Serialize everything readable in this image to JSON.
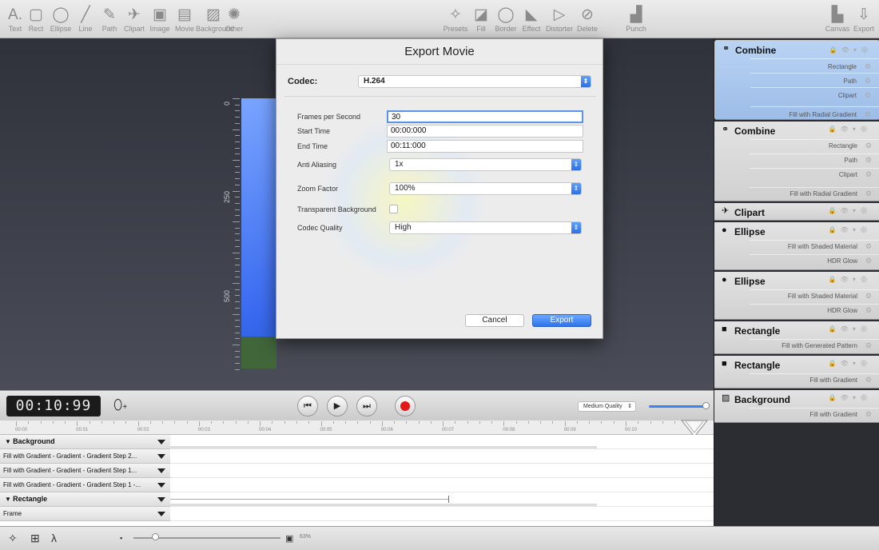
{
  "toolbar": {
    "left": [
      {
        "label": "Text",
        "icon": "text-tool-icon",
        "glyph": "A."
      },
      {
        "label": "Rect",
        "icon": "rect-tool-icon",
        "glyph": "▢"
      },
      {
        "label": "Ellipse",
        "icon": "ellipse-tool-icon",
        "glyph": "◯"
      },
      {
        "label": "Line",
        "icon": "line-tool-icon",
        "glyph": "╱"
      },
      {
        "label": "Path",
        "icon": "path-tool-icon",
        "glyph": "✎"
      },
      {
        "label": "Clipart",
        "icon": "clipart-tool-icon",
        "glyph": "✈"
      },
      {
        "label": "Image",
        "icon": "image-tool-icon",
        "glyph": "▣"
      },
      {
        "label": "Movie",
        "icon": "movie-tool-icon",
        "glyph": "▤"
      },
      {
        "label": "Background",
        "icon": "background-tool-icon",
        "glyph": "▨"
      },
      {
        "label": "Other",
        "icon": "other-tool-icon",
        "glyph": "✺"
      }
    ],
    "right": [
      {
        "label": "Presets",
        "icon": "presets-icon",
        "glyph": "✧"
      },
      {
        "label": "Fill",
        "icon": "fill-icon",
        "glyph": "◪"
      },
      {
        "label": "Border",
        "icon": "border-icon",
        "glyph": "◯"
      },
      {
        "label": "Effect",
        "icon": "effect-icon",
        "glyph": "◣"
      },
      {
        "label": "Distorter",
        "icon": "distorter-icon",
        "glyph": "▷"
      },
      {
        "label": "Delete",
        "icon": "delete-icon",
        "glyph": "⊘"
      }
    ],
    "punch": {
      "label": "Punch",
      "icon": "punch-icon",
      "glyph": "▟"
    },
    "canvas": {
      "label": "Canvas",
      "icon": "canvas-icon",
      "glyph": "▙"
    },
    "export": {
      "label": "Export",
      "icon": "export-icon",
      "glyph": "⇩"
    }
  },
  "ruler": {
    "labels": [
      "0",
      "250",
      "500"
    ]
  },
  "modal": {
    "title": "Export Movie",
    "codec_label": "Codec:",
    "codec_value": "H.264",
    "fps_label": "Frames per Second",
    "fps_value": "30",
    "start_label": "Start Time",
    "start_value": "00:00:000",
    "end_label": "End Time",
    "end_value": "00:11:000",
    "aa_label": "Anti Aliasing",
    "aa_value": "1x",
    "zoom_label": "Zoom Factor",
    "zoom_value": "100%",
    "transparent_label": "Transparent Background",
    "transparent_checked": false,
    "quality_label": "Codec Quality",
    "quality_value": "High",
    "cancel": "Cancel",
    "export": "Export"
  },
  "panel": [
    {
      "name": "Combine",
      "icon": "combine-icon",
      "glyph": "⚭",
      "selected": true,
      "items": [
        "Rectangle",
        "Path",
        "Clipart"
      ],
      "fill": "Fill with Radial Gradient"
    },
    {
      "name": "Combine",
      "icon": "combine-icon",
      "glyph": "⚭",
      "selected": false,
      "items": [
        "Rectangle",
        "Path",
        "Clipart"
      ],
      "fill": "Fill with Radial Gradient"
    },
    {
      "name": "Clipart",
      "icon": "clipart-icon",
      "glyph": "✈",
      "selected": false,
      "items": [],
      "fill": ""
    },
    {
      "name": "Ellipse",
      "icon": "ellipse-icon",
      "glyph": "●",
      "selected": false,
      "items": [
        "Fill with Shaded Material",
        "HDR Glow"
      ],
      "fill": ""
    },
    {
      "name": "Ellipse",
      "icon": "ellipse-icon",
      "glyph": "●",
      "selected": false,
      "items": [
        "Fill with Shaded Material",
        "HDR Glow"
      ],
      "fill": ""
    },
    {
      "name": "Rectangle",
      "icon": "rectangle-icon",
      "glyph": "■",
      "selected": false,
      "items": [
        "Fill with Generated Pattern"
      ],
      "fill": ""
    },
    {
      "name": "Rectangle",
      "icon": "rectangle-icon",
      "glyph": "■",
      "selected": false,
      "items": [
        "Fill with Gradient"
      ],
      "fill": ""
    },
    {
      "name": "Background",
      "icon": "background-icon",
      "glyph": "▨",
      "selected": false,
      "items": [
        "Fill with Gradient"
      ],
      "fill": ""
    }
  ],
  "transport": {
    "timecode": "00:10:99",
    "quality": "Medium Quality",
    "quality_slider_level": 1.0
  },
  "timeline": {
    "ticks": [
      "00:00",
      "00:01",
      "00:02",
      "00:03",
      "00:04",
      "00:05",
      "00:06",
      "00:07",
      "00:08",
      "00:09",
      "00:10"
    ],
    "tracks": [
      {
        "label": "Background",
        "header": true
      },
      {
        "label": "Fill with Gradient - Gradient - Gradient Step 2...",
        "header": false
      },
      {
        "label": "Fill with Gradient - Gradient - Gradient Step 1...",
        "header": false
      },
      {
        "label": "Fill with Gradient - Gradient - Gradient Step 1 -...",
        "header": false
      },
      {
        "label": "Rectangle",
        "header": true
      },
      {
        "label": "Frame",
        "header": false
      }
    ]
  },
  "statusbar": {
    "zoom": "63%",
    "zoom_level": 0.63
  }
}
